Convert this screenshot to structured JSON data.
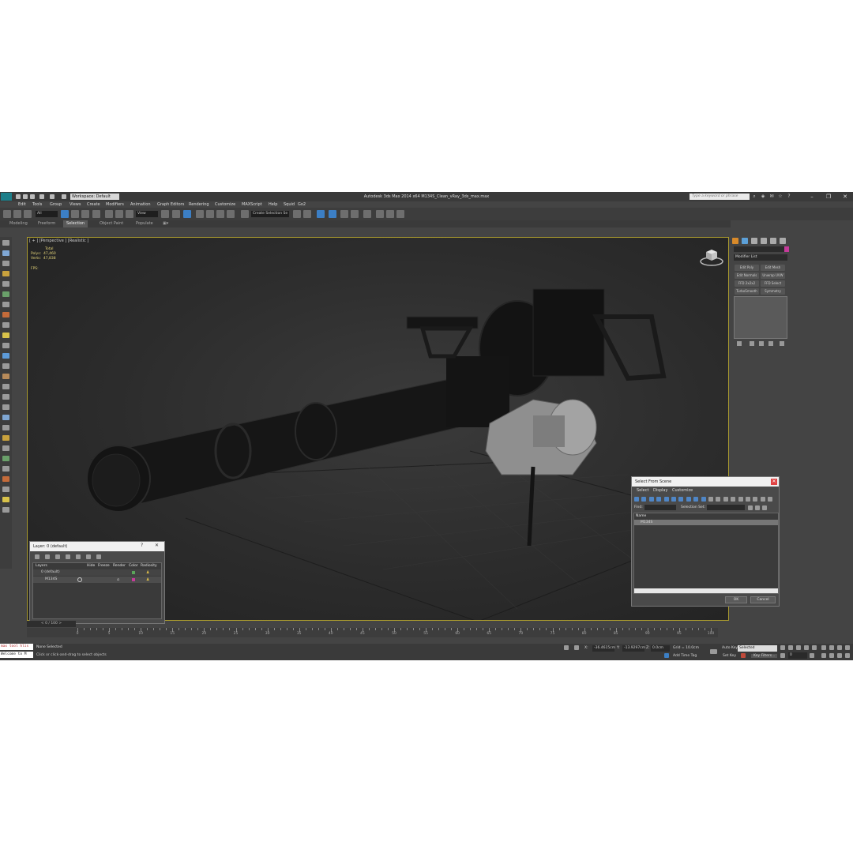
{
  "window": {
    "title": "Autodesk 3ds Max  2014 x64      M134S_Clean_vRay_3ds_max.max",
    "workspace": "Workspace: Default",
    "search_placeholder": "Type a keyword or phrase",
    "min": "–",
    "max": "❐",
    "close": "✕"
  },
  "menu": [
    "Edit",
    "Tools",
    "Group",
    "Views",
    "Create",
    "Modifiers",
    "Animation",
    "Graph Editors",
    "Rendering",
    "Customize",
    "MAXScript",
    "Help",
    "Squid",
    "Go2"
  ],
  "toolbar": {
    "selection_filter": "All",
    "view_combo": "View",
    "named_selection": "Create Selection Se"
  },
  "ribbon": {
    "tabs": [
      "Modeling",
      "Freeform",
      "Selection",
      "Object Paint",
      "Populate"
    ],
    "active": 2
  },
  "viewport": {
    "label": "[ + ] [Perspective ] [Realistic ]",
    "stats": {
      "total_label": "Total",
      "polys_label": "Polys:",
      "polys": "47,460",
      "verts_label": "Verts:",
      "verts": "47,838",
      "fps_label": "FPS:"
    }
  },
  "command_panel": {
    "modifier_list": "Modifier List",
    "buttons": [
      "Edit Poly",
      "Edit Mesh",
      "Edit Normals",
      "Unwrap UVW",
      "FFD 2x2x2",
      "FFD Select",
      "TurboSmooth",
      "Symmetry"
    ]
  },
  "layer_dialog": {
    "title": "Layer: 0 (default)",
    "help": "?",
    "close": "✕",
    "columns": [
      "Layers",
      "Hide",
      "Freeze",
      "Render",
      "Color",
      "Radiosity"
    ],
    "rows": [
      {
        "name": "0 (default)"
      },
      {
        "name": "M134S"
      }
    ]
  },
  "select_dialog": {
    "title": "Select From Scene",
    "close": "✕",
    "menu": [
      "Select",
      "Display",
      "Customize"
    ],
    "find_label": "Find:",
    "selection_set_label": "Selection Set:",
    "column_name": "Name",
    "items": [
      "M134S"
    ],
    "ok": "OK",
    "cancel": "Cancel"
  },
  "timeline": {
    "position": "0 / 100",
    "ticks": [
      0,
      5,
      10,
      15,
      20,
      25,
      30,
      35,
      40,
      45,
      50,
      55,
      60,
      65,
      70,
      75,
      80,
      85,
      90,
      95,
      100
    ],
    "prev": "<",
    "next": ">"
  },
  "status": {
    "listener_line1": "max tool hlis",
    "listener_line2": "Welcome to M",
    "selection": "None Selected",
    "prompt": "Click or click-and-drag to select objects",
    "x_label": "X:",
    "x_val": "-36.4615cm",
    "y_label": "Y:",
    "y_val": "-13.9297cm",
    "z_label": "Z:",
    "z_val": "0.0cm",
    "grid": "Grid = 10.0cm",
    "add_time_tag": "Add Time Tag",
    "auto_key": "Auto Key",
    "auto_key_mode": "Selected",
    "set_key": "Set Key",
    "key_filters": "Key Filters...",
    "frame": "0"
  },
  "colors": {
    "accent_blue": "#3c7fc5",
    "viewport_border": "#a99a2e",
    "stats_yellow": "#e6d67a",
    "object_color_swatch": "#c53b9a"
  }
}
